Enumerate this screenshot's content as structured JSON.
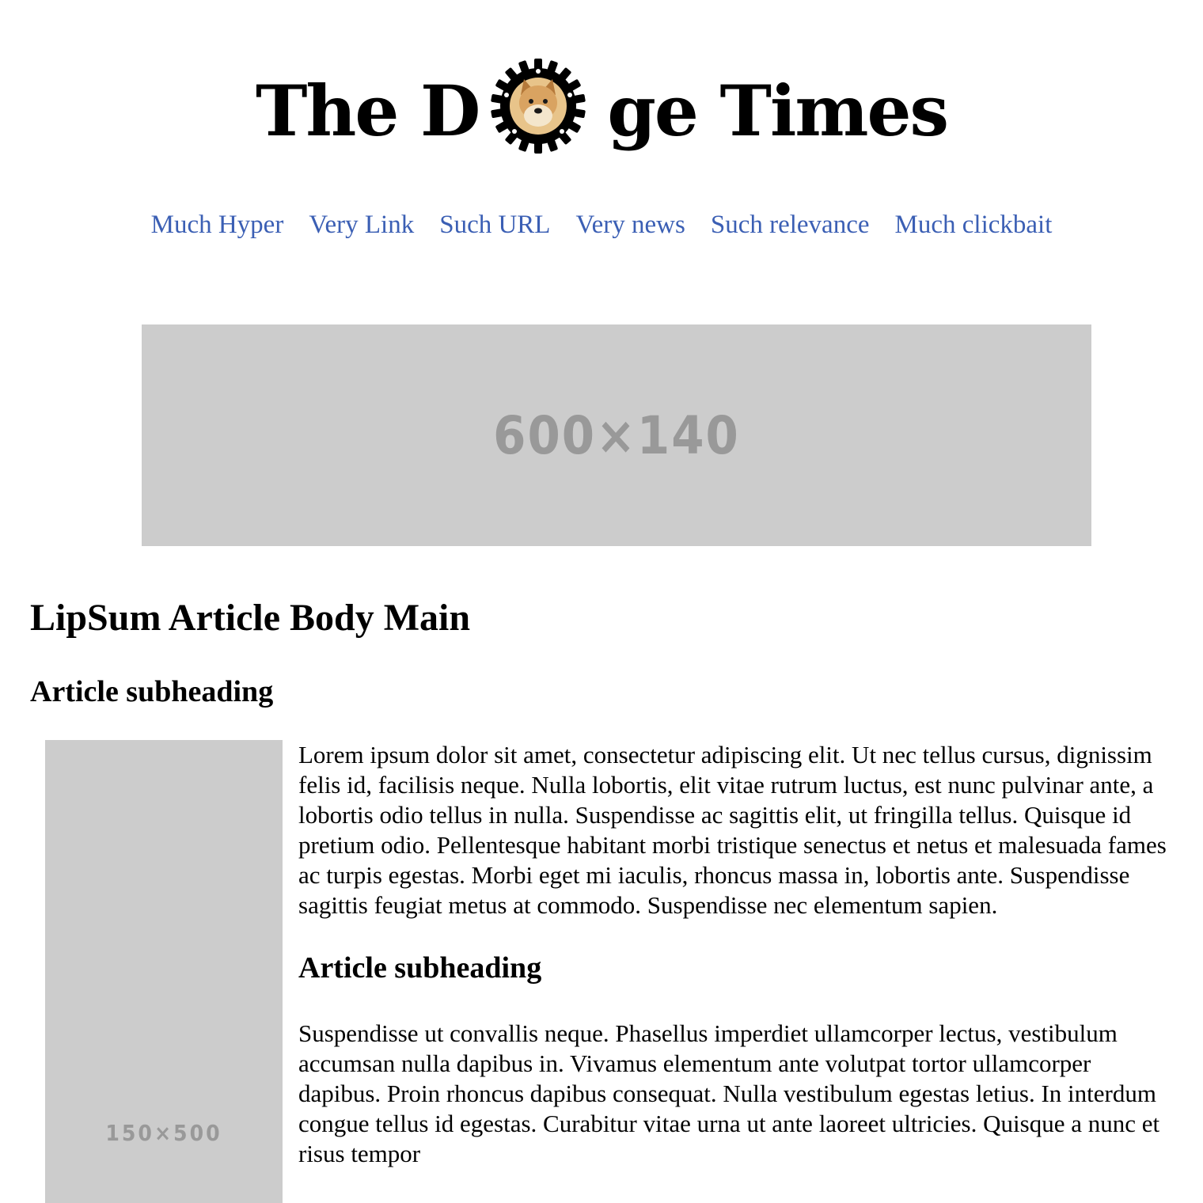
{
  "site": {
    "title_before": "The D",
    "title_after": "ge Times",
    "logo_icon": "doge-gear-icon"
  },
  "nav": {
    "items": [
      {
        "label": "Much Hyper"
      },
      {
        "label": "Very Link"
      },
      {
        "label": "Such URL"
      },
      {
        "label": "Very news"
      },
      {
        "label": "Such relevance"
      },
      {
        "label": "Much clickbait"
      }
    ],
    "link_color": "#3b5fb4"
  },
  "banner": {
    "label": "600×140"
  },
  "article": {
    "title": "LipSum Article Body Main",
    "subheading_1": "Article subheading",
    "sidebar_image_label": "150×500",
    "paragraph_1": "Lorem ipsum dolor sit amet, consectetur adipiscing elit. Ut nec tellus cursus, dignissim felis id, facilisis neque. Nulla lobortis, elit vitae rutrum luctus, est nunc pulvinar ante, a lobortis odio tellus in nulla. Suspendisse ac sagittis elit, ut fringilla tellus. Quisque id pretium odio. Pellentesque habitant morbi tristique senectus et netus et malesuada fames ac turpis egestas. Morbi eget mi iaculis, rhoncus massa in, lobortis ante. Suspendisse sagittis feugiat metus at commodo. Suspendisse nec elementum sapien.",
    "subheading_2": "Article subheading",
    "paragraph_2": "Suspendisse ut convallis neque. Phasellus imperdiet ullamcorper lectus, vestibulum accumsan nulla dapibus in. Vivamus elementum ante volutpat tortor ullamcorper dapibus. Proin rhoncus dapibus consequat. Nulla vestibulum egestas letius. In interdum congue tellus id egestas. Curabitur vitae urna ut ante laoreet ultricies. Quisque a nunc et risus tempor"
  },
  "colors": {
    "placeholder_bg": "#cccccc",
    "placeholder_text": "#999999"
  }
}
